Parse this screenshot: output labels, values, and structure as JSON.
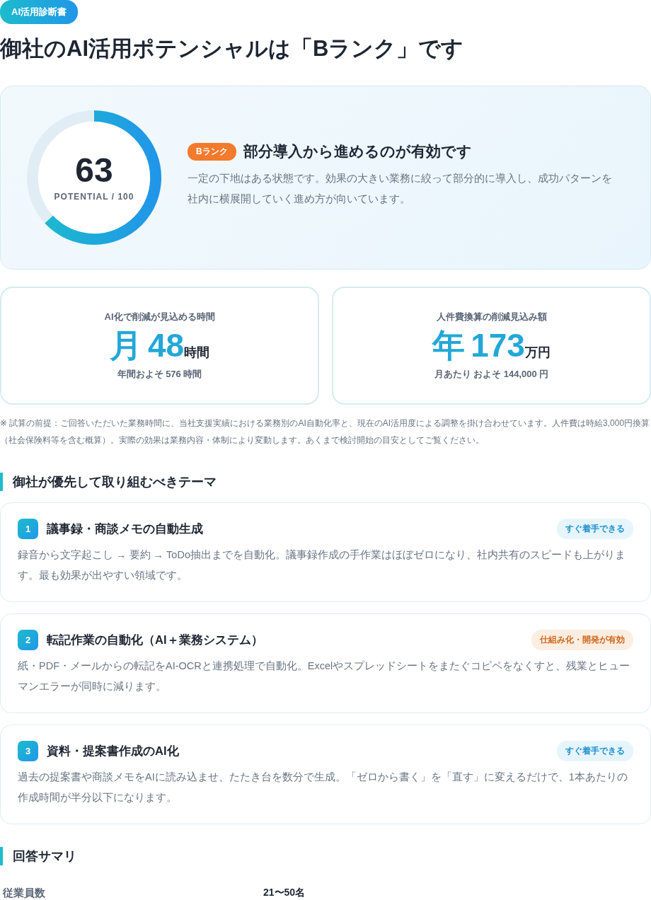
{
  "badge": "AI活用診断書",
  "title": "御社のAI活用ポテンシャルは「Bランク」です",
  "score": {
    "value": "63",
    "label": "POTENTIAL / 100",
    "level": 0.63,
    "rank": "Bランク",
    "headline": "部分導入から進めるのが有効です",
    "description": "一定の下地はある状態です。効果の大きい業務に絞って部分的に導入し、成功パターンを社内に横展開していく進め方が向いています。"
  },
  "metrics": [
    {
      "label": "AI化で削減が見込める時間",
      "prefix": "月",
      "value": "48",
      "unit": "時間",
      "sub": "年間およそ 576 時間"
    },
    {
      "label": "人件費換算の削減見込み額",
      "prefix": "年",
      "value": "173",
      "unit": "万円",
      "sub": "月あたり およそ 144,000 円"
    }
  ],
  "note": "※ 試算の前提：ご回答いただいた業務時間に、当社支援実績における業務別のAI自動化率と、現在のAI活用度による調整を掛け合わせています。人件費は時給3,000円換算（社会保険料等を含む概算）。実際の効果は業務内容・体制により変動します。あくまで検討開始の目安としてご覧ください。",
  "themes_heading": "御社が優先して取り組むべきテーマ",
  "themes": [
    {
      "number": "1",
      "title": "議事録・商談メモの自動生成",
      "tag": "すぐ着手できる",
      "kind": "quick",
      "description": "録音から文字起こし → 要約 → ToDo抽出までを自動化。議事録作成の手作業はほぼゼロになり、社内共有のスピードも上がります。最も効果が出やすい領域です。"
    },
    {
      "number": "2",
      "title": "転記作業の自動化（AI＋業務システム）",
      "tag": "仕組み化・開発が有効",
      "kind": "dev",
      "description": "紙・PDF・メールからの転記をAI-OCRと連携処理で自動化。Excelやスプレッドシートをまたぐコピペをなくすと、残業とヒューマンエラーが同時に減ります。"
    },
    {
      "number": "3",
      "title": "資料・提案書作成のAI化",
      "tag": "すぐ着手できる",
      "kind": "quick",
      "description": "過去の提案書や商談メモをAIに読み込ませ、たたき台を数分で生成。「ゼロから書く」を「直す」に変えるだけで、1本あたりの作成時間が半分以下になります。"
    }
  ],
  "summary_heading": "回答サマリ",
  "summary": [
    {
      "label": "従業員数",
      "value": "21〜50名"
    }
  ]
}
